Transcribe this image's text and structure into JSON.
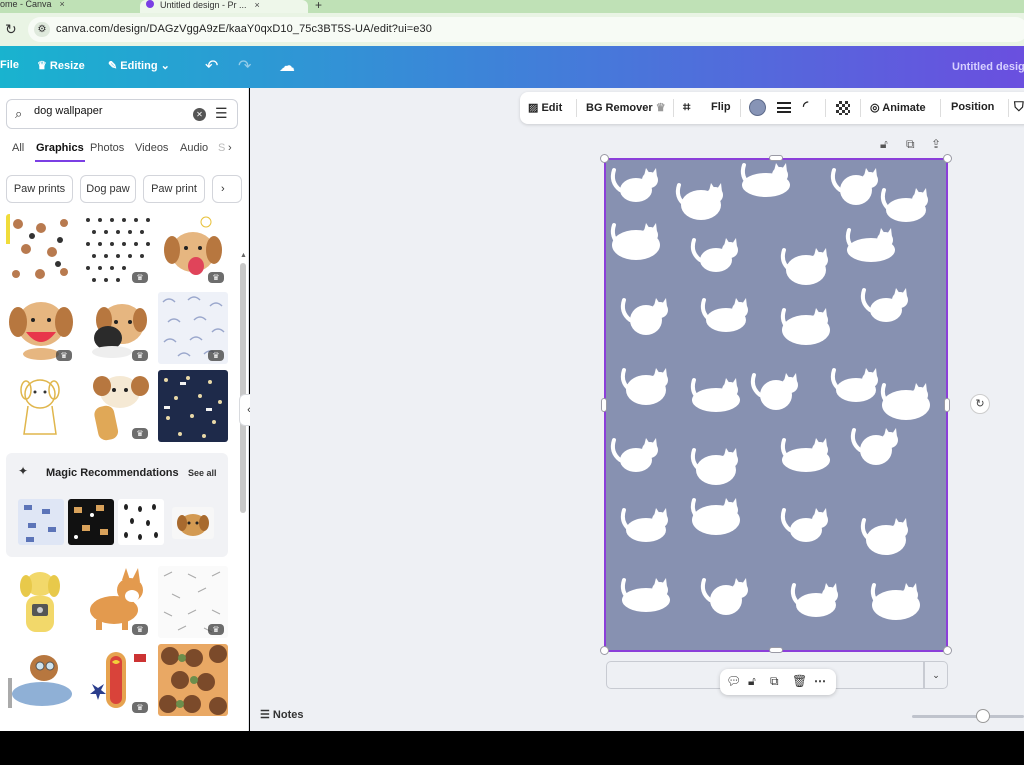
{
  "browser": {
    "tabs": [
      {
        "label": "ome - Canva",
        "active": false
      },
      {
        "label": "Untitled design - Pr ...",
        "active": true
      }
    ],
    "new_tab": "+",
    "url": "canva.com/design/DAGzVggA9zE/kaaY0qxD10_75c3BT5S-UA/edit?ui=e30"
  },
  "header": {
    "file": "File",
    "resize": "Resize",
    "editing": "Editing",
    "title": "Untitled design"
  },
  "panel": {
    "search_value": "dog wallpaper",
    "category_tabs": [
      "All",
      "Graphics",
      "Photos",
      "Videos",
      "Audio",
      "S"
    ],
    "active_tab": "Graphics",
    "chips": [
      "Paw prints",
      "Dog paw",
      "Paw print"
    ],
    "magic": {
      "title": "Magic Recommendations",
      "see_all": "See all"
    }
  },
  "toolbar": {
    "edit": "Edit",
    "bg_remover": "BG Remover",
    "flip": "Flip",
    "animate": "Animate",
    "position": "Position",
    "color": "#8794b6"
  },
  "design": {
    "background": "#8791b1"
  },
  "footer": {
    "notes": "Notes",
    "zoom_fraction": 0.58
  },
  "colors": {
    "accent": "#7b3fe4",
    "selection": "#8b3fd9"
  }
}
